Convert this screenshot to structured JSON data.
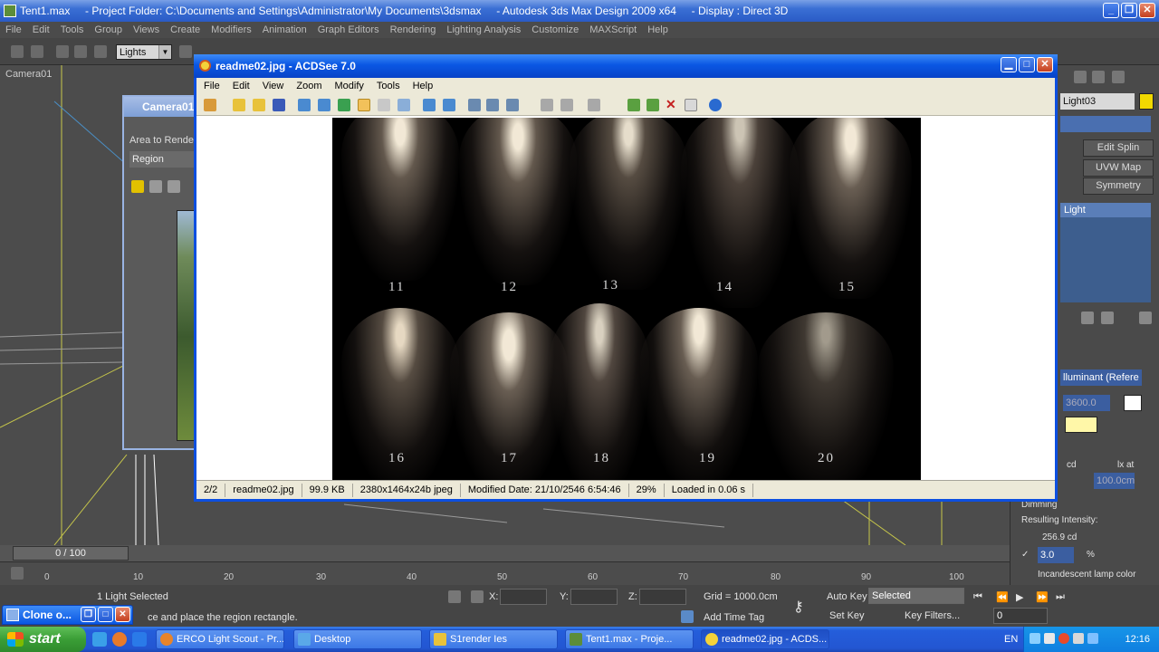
{
  "max": {
    "title": "Tent1.max     - Project Folder: C:\\Documents and Settings\\Administrator\\My Documents\\3dsmax     - Autodesk 3ds Max Design 2009 x64     - Display : Direct 3D",
    "menu": [
      "File",
      "Edit",
      "Tools",
      "Group",
      "Views",
      "Create",
      "Modifiers",
      "Animation",
      "Graph Editors",
      "Rendering",
      "Lighting Analysis",
      "Customize",
      "MAXScript",
      "Help"
    ],
    "selection_filter": "Lights",
    "viewport_label": "Camera01"
  },
  "command_panel": {
    "object_name": "Light03",
    "buttons": [
      "Edit Splin",
      "UVW Map",
      "Symmetry"
    ],
    "list_item": "Light",
    "color_model": "lluminant (Refere",
    "kelvin": "3600.0",
    "unit_cd": "cd",
    "unit_lxat": "lx at",
    "distance": "100.0cm",
    "dimming_label": "Dimming",
    "resulting_label": "Resulting Intensity:",
    "resulting_value": "256.9 cd",
    "dim_percent": "3.0",
    "percent_sign": "%",
    "incandescent": "Incandescent lamp color"
  },
  "render_dialog": {
    "title": "Camera01",
    "area_label": "Area to Render:",
    "area_value": "Region"
  },
  "acdsee": {
    "title": "readme02.jpg - ACDSee 7.0",
    "menu": [
      "File",
      "Edit",
      "View",
      "Zoom",
      "Modify",
      "Tools",
      "Help"
    ],
    "photo_labels": [
      "11",
      "12",
      "13",
      "14",
      "15",
      "16",
      "17",
      "18",
      "19",
      "20"
    ],
    "status": {
      "index": "2/2",
      "filename": "readme02.jpg",
      "filesize": "99.9 KB",
      "dimensions": "2380x1464x24b jpeg",
      "modified": "Modified Date: 21/10/2546 6:54:46",
      "zoom": "29%",
      "loaded": "Loaded in 0.06 s"
    }
  },
  "timeline": {
    "frame": "0 / 100",
    "ticks": [
      "0",
      "10",
      "20",
      "30",
      "40",
      "50",
      "60",
      "70",
      "80",
      "90",
      "100"
    ]
  },
  "status_bar": {
    "selected_count": "1 Light Selected",
    "prompt": "ce and place the region rectangle.",
    "x_label": "X:",
    "y_label": "Y:",
    "z_label": "Z:",
    "grid": "Grid = 1000.0cm",
    "add_time_tag": "Add Time Tag",
    "auto_key": "Auto Key",
    "set_key": "Set Key",
    "key_mode": "Selected",
    "key_filters": "Key Filters...",
    "current_frame": "0"
  },
  "clone_window": {
    "title": "Clone o..."
  },
  "taskbar": {
    "start_label": "start",
    "tasks": [
      "ERCO Light Scout - Pr...",
      "Desktop",
      "S1render Ies",
      "Tent1.max      - Proje...",
      "readme02.jpg - ACDS..."
    ],
    "language": "EN",
    "clock": "12:16"
  },
  "colors": {
    "xp_blue": "#0a57e3",
    "max_grey": "#4b4b4b",
    "start_green": "#3a9e36"
  }
}
